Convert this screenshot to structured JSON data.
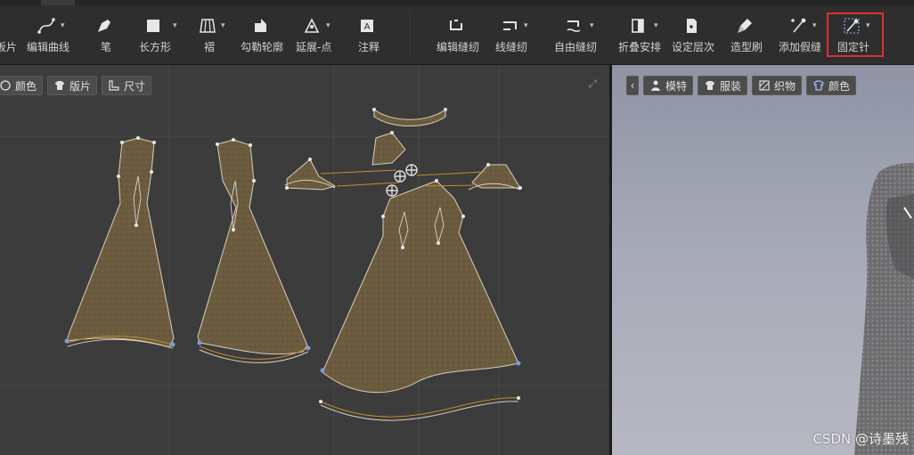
{
  "toolbar": {
    "tools": [
      {
        "id": "pattern",
        "label": "板片",
        "icon": "pattern-icon",
        "dropdown": false
      },
      {
        "id": "edit-curve",
        "label": "编辑曲线",
        "icon": "edit-curve-icon",
        "dropdown": true
      },
      {
        "id": "pen",
        "label": "笔",
        "icon": "pen-icon",
        "dropdown": false
      },
      {
        "id": "rectangle",
        "label": "长方形",
        "icon": "rectangle-icon",
        "dropdown": true
      },
      {
        "id": "pleat",
        "label": "褶",
        "icon": "pleat-icon",
        "dropdown": true
      },
      {
        "id": "trace-outline",
        "label": "勾勒轮廓",
        "icon": "trace-outline-icon",
        "dropdown": false
      },
      {
        "id": "extend-point",
        "label": "延展-点",
        "icon": "extend-point-icon",
        "dropdown": true
      },
      {
        "id": "annotation",
        "label": "注释",
        "icon": "annotation-icon",
        "dropdown": false
      },
      {
        "id": "edit-sewing",
        "label": "编辑缝纫",
        "icon": "edit-sewing-icon",
        "dropdown": false
      },
      {
        "id": "line-sewing",
        "label": "线缝纫",
        "icon": "line-sewing-icon",
        "dropdown": true
      },
      {
        "id": "free-sewing",
        "label": "自由缝纫",
        "icon": "free-sewing-icon",
        "dropdown": true
      },
      {
        "id": "fold-arrange",
        "label": "折叠安排",
        "icon": "fold-arrange-icon",
        "dropdown": true
      },
      {
        "id": "set-layer",
        "label": "设定层次",
        "icon": "set-layer-icon",
        "dropdown": false
      },
      {
        "id": "style-brush",
        "label": "造型刷",
        "icon": "style-brush-icon",
        "dropdown": false
      },
      {
        "id": "add-tack",
        "label": "添加假缝",
        "icon": "add-tack-icon",
        "dropdown": true
      },
      {
        "id": "pin",
        "label": "固定针",
        "icon": "pin-icon",
        "dropdown": true
      }
    ]
  },
  "pane2d": {
    "chips": [
      {
        "id": "color",
        "label": "颜色",
        "icon": "color-icon"
      },
      {
        "id": "pattern",
        "label": "版片",
        "icon": "pattern-shirt-icon"
      },
      {
        "id": "size",
        "label": "尺寸",
        "icon": "ruler-icon"
      }
    ]
  },
  "pane3d": {
    "chips": [
      {
        "id": "avatar",
        "label": "模特",
        "icon": "avatar-icon"
      },
      {
        "id": "garment",
        "label": "服装",
        "icon": "garment-icon"
      },
      {
        "id": "fabric",
        "label": "织物",
        "icon": "fabric-icon"
      },
      {
        "id": "color",
        "label": "颜色",
        "icon": "color-icon"
      }
    ]
  },
  "watermark": "CSDN @诗墨残",
  "colors": {
    "accent": "#e03030",
    "fabric": "#6a5a3e",
    "stitch": "#c98a2a"
  }
}
